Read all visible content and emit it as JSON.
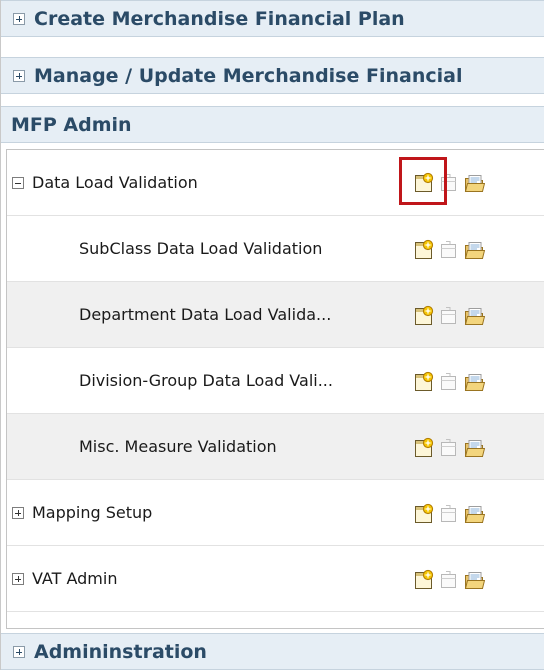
{
  "accordion": {
    "create_plan": "Create Merchandise Financial Plan",
    "manage_plan": "Manage / Update Merchandise Financial",
    "mfp_admin": "MFP Admin",
    "administration": "Admininstration"
  },
  "tasks": [
    {
      "label": "Data Load Validation",
      "expander": "minus"
    },
    {
      "label": "SubClass Data Load Validation"
    },
    {
      "label": "Department Data Load Valida..."
    },
    {
      "label": "Division-Group Data Load Vali..."
    },
    {
      "label": "Misc. Measure Validation"
    },
    {
      "label": "Mapping Setup",
      "expander": "plus"
    },
    {
      "label": "VAT Admin",
      "expander": "plus"
    }
  ],
  "icons": [
    "new-workbook-icon",
    "open-workbook-icon",
    "browse-folder-icon"
  ],
  "colors": {
    "header_bg": "#e6eef5",
    "header_text": "#2b4b67",
    "highlight": "#c0161a"
  }
}
